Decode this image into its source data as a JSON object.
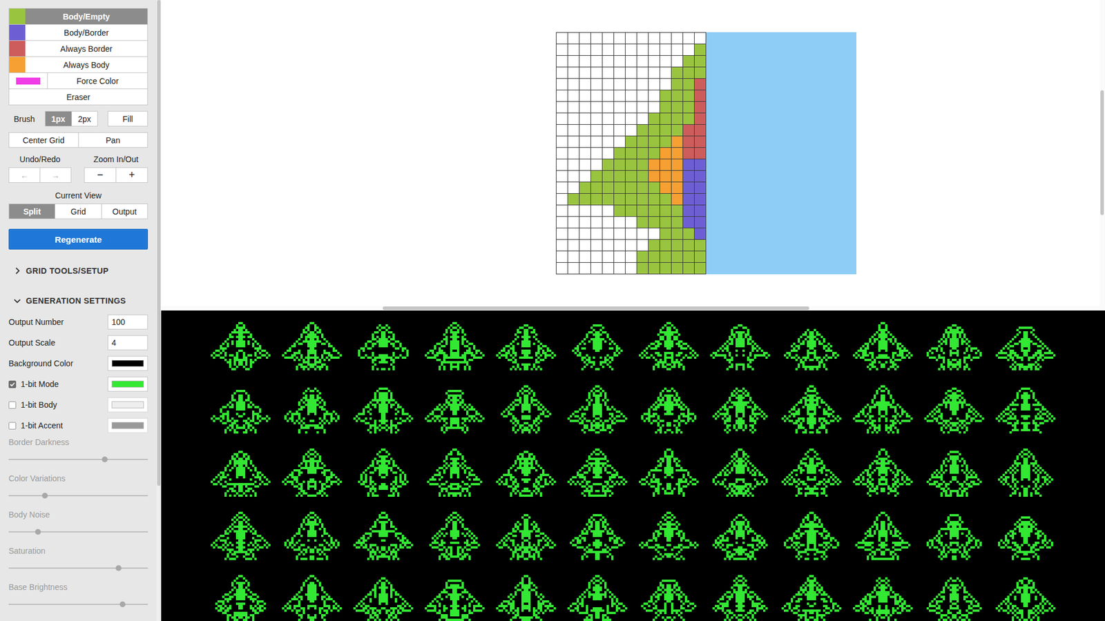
{
  "palette": [
    {
      "label": "Body/Empty",
      "kind": "swatch",
      "color": "#99c43f",
      "selected": true
    },
    {
      "label": "Body/Border",
      "kind": "swatch",
      "color": "#6d5fd3",
      "selected": false
    },
    {
      "label": "Always Border",
      "kind": "swatch",
      "color": "#cd5c5c",
      "selected": false
    },
    {
      "label": "Always Body",
      "kind": "swatch",
      "color": "#f6a033",
      "selected": false
    },
    {
      "label": "Force Color",
      "kind": "wide",
      "color": "#f03ce6",
      "selected": false
    },
    {
      "label": "Eraser",
      "kind": "plain",
      "color": "#ffffff",
      "selected": false
    }
  ],
  "brush": {
    "label": "Brush",
    "options": [
      {
        "label": "1px",
        "selected": true
      },
      {
        "label": "2px",
        "selected": false
      }
    ],
    "fill": "Fill"
  },
  "grid_buttons": [
    "Center Grid",
    "Pan"
  ],
  "history": {
    "label": "Undo/Redo",
    "buttons": [
      {
        "label": "←",
        "disabled": true
      },
      {
        "label": "→",
        "disabled": true
      }
    ]
  },
  "zoom": {
    "label": "Zoom In/Out",
    "buttons": [
      {
        "label": "−",
        "disabled": false
      },
      {
        "label": "+",
        "disabled": false
      }
    ]
  },
  "view": {
    "label": "Current View",
    "options": [
      {
        "label": "Split",
        "selected": true
      },
      {
        "label": "Grid",
        "selected": false
      },
      {
        "label": "Output",
        "selected": false
      }
    ]
  },
  "regenerate": "Regenerate",
  "sections": [
    {
      "title": "GRID TOOLS/SETUP",
      "expanded": false
    }
  ],
  "settings": {
    "title": "GENERATION SETTINGS",
    "expanded": true,
    "fields": [
      {
        "kind": "text",
        "label": "Output Number",
        "value": "100"
      },
      {
        "kind": "text",
        "label": "Output Scale",
        "value": "4"
      },
      {
        "kind": "color",
        "label": "Background Color",
        "checked": false,
        "color": "#000000"
      },
      {
        "kind": "check",
        "label": "1-bit Mode",
        "checked": true,
        "color": "#33e833"
      },
      {
        "kind": "check",
        "label": "1-bit Body",
        "checked": false,
        "color": "#eeeeee"
      },
      {
        "kind": "check",
        "label": "1-bit Accent",
        "checked": false,
        "color": "#999999"
      }
    ],
    "sliders": [
      {
        "label": "Border Darkness",
        "level": 0.69,
        "disabled": true
      },
      {
        "label": "Color Variations",
        "level": 0.26,
        "disabled": true
      },
      {
        "label": "Body Noise",
        "level": 0.21,
        "disabled": true
      },
      {
        "label": "Saturation",
        "level": 0.79,
        "disabled": true
      },
      {
        "label": "Base Brightness",
        "level": 0.82,
        "disabled": true
      }
    ]
  },
  "grid": {
    "rows": [
      ".............",
      "............g",
      "...........gg",
      "..........ggg",
      "..........ggr",
      ".........gggr",
      ".........gggr",
      "........ggggr",
      ".......ggggrr",
      "......ggggorr",
      ".....ggggoorr",
      "....ggggooobb",
      "...gggggooobb",
      "..gggggggoobb",
      ".gggggggggobb",
      ".....ggggggbb",
      ".......ggggbb",
      ".........gggb",
      "........ggggg",
      ".......gggggg",
      ".......gggggg"
    ]
  }
}
